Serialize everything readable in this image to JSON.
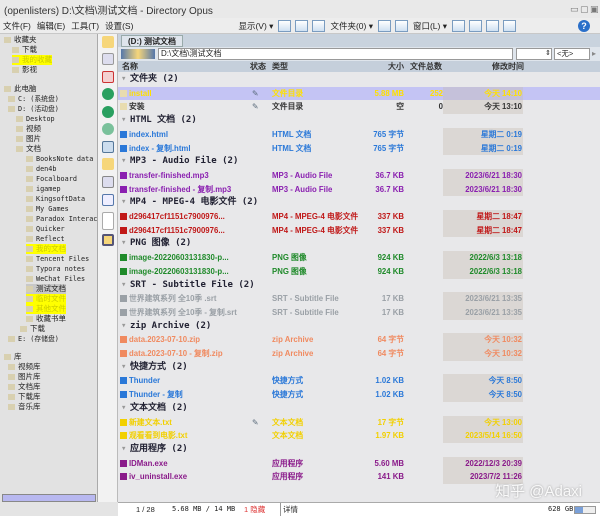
{
  "title": "(openlisters) D:\\文档\\测试文档 - Directory Opus",
  "menu": {
    "file": "文件(F)",
    "edit": "编辑(E)",
    "tools": "工具(T)",
    "settings": "设置(S)",
    "view": "显示(V) ▾",
    "folder": "文件夹(0) ▾",
    "window": "窗口(L) ▾"
  },
  "tree": {
    "favorites": "收藏夹",
    "fav_items": [
      "下载",
      "我的收藏",
      "影视"
    ],
    "pc": "此电脑",
    "drive_c": "C: (系统盘)",
    "drive_d": "D: (活动盘)",
    "d_items": [
      "Desktop",
      "视频",
      "图片",
      "文档"
    ],
    "doc_items": [
      "BooksNote data",
      "den4b",
      "Focalboard",
      "igamep",
      "KingsoftData",
      "My Games",
      "Paradox Interactive",
      "Quicker",
      "Reflect",
      "我的文档",
      "Tencent Files",
      "Typora notes",
      "WeChat Files",
      "测试文档",
      "临时文件",
      "其他文件",
      "收藏书单"
    ],
    "downloads": "下载",
    "drive_e": "E: (存储盘)",
    "libs": "库",
    "lib_items": [
      "视频库",
      "图片库",
      "文档库",
      "下载库",
      "音乐库"
    ]
  },
  "tab": "(D:) 测试文档",
  "path": "D:\\文档\\测试文档",
  "filter_none": "<无>",
  "columns": {
    "name": "名称",
    "status": "状态",
    "type": "类型",
    "size": "大小",
    "count": "文件总数",
    "mtime": "修改时间"
  },
  "colors": {
    "folder": "#ffe000",
    "html": "#2a78d8",
    "mp3": "#8a1fb0",
    "mp4": "#c01818",
    "png": "#1f8a2a",
    "srt": "#9aa0a6",
    "zip": "#f08a60",
    "lnk": "#2a78d8",
    "txt": "#f2d000",
    "exe": "#8a1a8a"
  },
  "rows": [
    {
      "g": "文件夹 (2)"
    },
    {
      "n": "install",
      "t": "文件目录",
      "s": "5.88 MB",
      "c": "252",
      "d": "今天 14:10",
      "k": "folder",
      "sel": true,
      "st": "✎"
    },
    {
      "n": "安装",
      "t": "文件目录",
      "s": "空",
      "c": "0",
      "d": "今天 13:10",
      "k": "plain",
      "st": "✎"
    },
    {
      "g": "HTML 文档 (2)"
    },
    {
      "n": "index.html",
      "t": "HTML 文档",
      "s": "765 字节",
      "d": "星期二  0:19",
      "k": "html",
      "u": true
    },
    {
      "n": "index - 复制.html",
      "t": "HTML 文档",
      "s": "765 字节",
      "d": "星期二  0:19",
      "k": "html",
      "u": true
    },
    {
      "g": "MP3 - Audio File (2)"
    },
    {
      "n": "transfer-finished.mp3",
      "t": "MP3 - Audio File",
      "s": "36.7 KB",
      "d": "2023/6/21 18:30",
      "k": "mp3"
    },
    {
      "n": "transfer-finished - 复制.mp3",
      "t": "MP3 - Audio File",
      "s": "36.7 KB",
      "d": "2023/6/21 18:30",
      "k": "mp3"
    },
    {
      "g": "MP4 - MPEG-4 电影文件 (2)"
    },
    {
      "n": "d296417cf1151c7900976...",
      "t": "MP4 - MPEG-4 电影文件",
      "s": "337 KB",
      "d": "星期二 18:47",
      "k": "mp4"
    },
    {
      "n": "d296417cf1151c7900976...",
      "t": "MP4 - MPEG-4 电影文件",
      "s": "337 KB",
      "d": "星期二 18:47",
      "k": "mp4"
    },
    {
      "g": "PNG 图像 (2)"
    },
    {
      "n": "image-20220603131830-p...",
      "t": "PNG 图像",
      "s": "924 KB",
      "d": "2022/6/3 13:18",
      "k": "png"
    },
    {
      "n": "image-20220603131830-p...",
      "t": "PNG 图像",
      "s": "924 KB",
      "d": "2022/6/3 13:18",
      "k": "png"
    },
    {
      "g": "SRT - Subtitle File (2)"
    },
    {
      "n": "世界建筑系列 全10季 .srt",
      "t": "SRT - Subtitle File",
      "s": "17 KB",
      "d": "2023/6/21 13:35",
      "k": "srt"
    },
    {
      "n": "世界建筑系列 全10季 - 复制.srt",
      "t": "SRT - Subtitle File",
      "s": "17 KB",
      "d": "2023/6/21 13:35",
      "k": "srt"
    },
    {
      "g": "zip Archive (2)"
    },
    {
      "n": "data.2023-07-10.zip",
      "t": "zip Archive",
      "s": "64 字节",
      "d": "今天 10:32",
      "k": "zip"
    },
    {
      "n": "data.2023-07-10 - 复制.zip",
      "t": "zip Archive",
      "s": "64 字节",
      "d": "今天 10:32",
      "k": "zip"
    },
    {
      "g": "快捷方式 (2)"
    },
    {
      "n": "Thunder",
      "t": "快捷方式",
      "s": "1.02 KB",
      "d": "今天  8:50",
      "k": "lnk",
      "u": true
    },
    {
      "n": "Thunder - 复制",
      "t": "快捷方式",
      "s": "1.02 KB",
      "d": "今天  8:50",
      "k": "lnk",
      "u": true
    },
    {
      "g": "文本文档 (2)"
    },
    {
      "n": "新建文本.txt",
      "t": "文本文档",
      "s": "17 字节",
      "d": "今天 13:00",
      "k": "txt",
      "st": "✎"
    },
    {
      "n": "观看看到电影.txt",
      "t": "文本文档",
      "s": "1.97 KB",
      "d": "2023/5/14 16:50",
      "k": "txt"
    },
    {
      "g": "应用程序 (2)"
    },
    {
      "n": "IDMan.exe",
      "t": "应用程序",
      "s": "5.60 MB",
      "d": "2022/12/3 20:39",
      "k": "exe"
    },
    {
      "n": "iv_uninstall.exe",
      "t": "应用程序",
      "s": "141 KB",
      "d": "2023/7/2 11:26",
      "k": "exe"
    }
  ],
  "status": {
    "count": "1 / 28",
    "size": "5.68 MB / 14 MB",
    "hidden": "1 隐藏",
    "details": "详情",
    "free": "628 GB"
  },
  "watermark": "知乎 @Adaxi"
}
